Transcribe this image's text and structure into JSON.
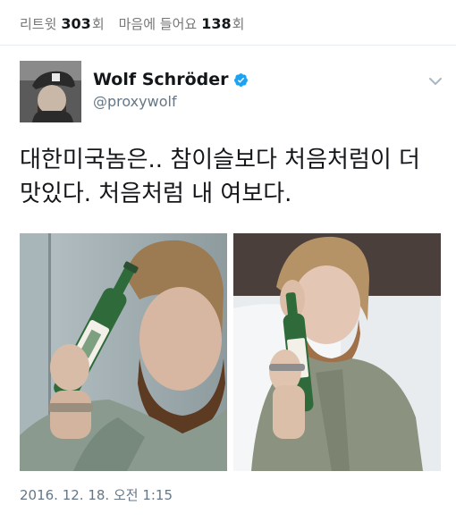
{
  "stats": {
    "retweet_label": "리트윗",
    "retweet_count": "303",
    "retweet_unit": "회",
    "like_label": "마음에 들어요",
    "like_count": "138",
    "like_unit": "회"
  },
  "author": {
    "display_name": "Wolf Schröder",
    "handle": "@proxywolf",
    "verified": true
  },
  "tweet": {
    "text_line1": "대한미국놈은.. 참이슬보다 처음처럼이 더",
    "text_line2": "맛있다. 처음처럼 내 여보다."
  },
  "timestamp": "2016. 12. 18. 오전 1:15",
  "colors": {
    "text": "#14171a",
    "secondary": "#657786",
    "verified_blue": "#1da1f2",
    "divider": "#e6ecf0",
    "bottle_green": "#2f6b3a"
  },
  "icons": {
    "verified": "verified-badge-icon",
    "menu": "chevron-down-icon"
  }
}
